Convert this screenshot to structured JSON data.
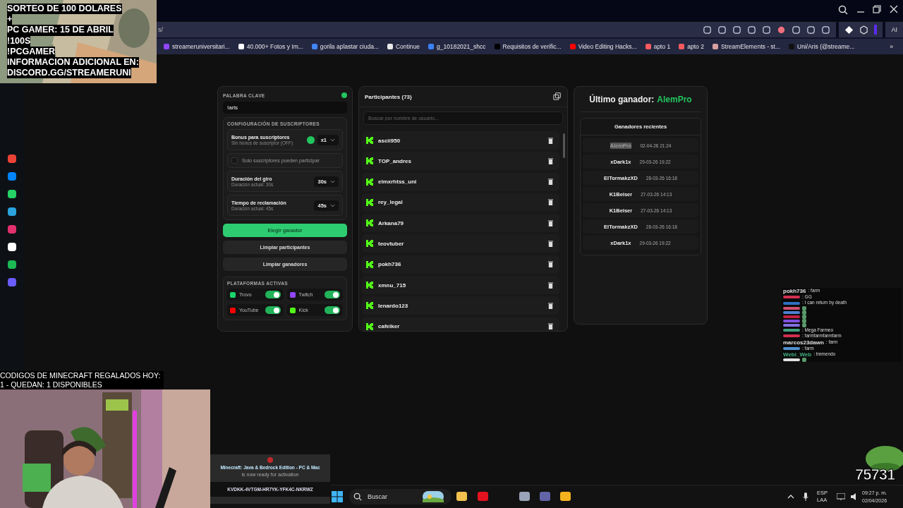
{
  "promo_overlay": {
    "lines": [
      "SORTEO DE 100 DOLARES",
      "+",
      "PC GAMER: 15 DE ABRIL",
      "!100S",
      "!PCGAMER",
      "INFORMACION ADICIONAL EN:",
      "DISCORD.GG/STREAMERUNI"
    ]
  },
  "browser": {
    "address": "s/",
    "bookmarks": [
      {
        "label": "streameruniversitari...",
        "kind": "twitch"
      },
      {
        "label": "40.000+ Fotos y Im...",
        "kind": "pexels"
      },
      {
        "label": "gorila aplastar ciuda...",
        "kind": "google"
      },
      {
        "label": "Continue",
        "kind": "doc"
      },
      {
        "label": "g_10182021_shcc",
        "kind": "edge"
      },
      {
        "label": "Requisitos de verific...",
        "kind": "x"
      },
      {
        "label": "Video Editing Hacks...",
        "kind": "youtube"
      },
      {
        "label": "apto 1",
        "kind": "airbnb"
      },
      {
        "label": "apto 2",
        "kind": "airbnb2"
      },
      {
        "label": "StreamElements - st...",
        "kind": "se"
      },
      {
        "label": "Uni/Aris (@streame...",
        "kind": "tiktok"
      }
    ],
    "more": "»",
    "ai": "AI"
  },
  "settings": {
    "keyword_label": "PALABRA CLAVE",
    "keyword": "!aris",
    "subs_title": "CONFIGURACIÓN DE SUSCRIPTORES",
    "options": [
      {
        "kind": "select",
        "title": "Bonus para suscriptores",
        "subtitle": "Sin bonus de suscriptor (OFF)",
        "value": "x1",
        "info": true
      },
      {
        "kind": "checkbox",
        "title": "Solo suscriptores pueden participar",
        "checked": false
      },
      {
        "kind": "select",
        "title": "Duración del giro",
        "subtitle": "Duración actual: 30s",
        "value": "30s",
        "info": false
      },
      {
        "kind": "select",
        "title": "Tiempo de reclamación",
        "subtitle": "Duración actual: 45s",
        "value": "45s",
        "info": false
      }
    ],
    "buttons": [
      {
        "label": "Elegir ganador",
        "kind": "primary"
      },
      {
        "label": "Limpiar participantes",
        "kind": "secondary"
      },
      {
        "label": "Limpiar ganadores",
        "kind": "secondary"
      }
    ],
    "platforms_title": "PLATAFORMAS ACTIVAS",
    "platforms": [
      {
        "name": "Trovo",
        "kind": "trovo",
        "on": true
      },
      {
        "name": "Twitch",
        "kind": "twitch",
        "on": true
      },
      {
        "name": "YouTube",
        "kind": "youtube",
        "on": true
      },
      {
        "name": "Kick",
        "kind": "kick",
        "on": true
      }
    ]
  },
  "participants": {
    "title": "Participantes (73)",
    "search": {
      "placeholder": "Buscar por nombre de usuario..."
    },
    "names": [
      "ascii950",
      "TOP_andres",
      "elmxrhtss_uni",
      "rey_legal",
      "Arkana79",
      "teovtuber",
      "pokh736",
      "xmnu_715",
      "lenardo123",
      "cafeiker"
    ]
  },
  "winner": {
    "label": "Último ganador:",
    "name": "AlemPro",
    "recent_title": "Ganadores recientes",
    "recent": [
      {
        "name": "AlemPro",
        "date": "02-04-26 21:24",
        "selected": true
      },
      {
        "name": "xDark1x",
        "date": "29-03-26 19:22",
        "selected": false
      },
      {
        "name": "ElTormakzXD",
        "date": "28-03-26 16:18",
        "selected": false
      },
      {
        "name": "K1Beiser",
        "date": "27-03-26 14:13",
        "selected": false
      },
      {
        "name": "K1Beiser",
        "date": "27-03-26 14:13",
        "selected": false
      },
      {
        "name": "ElTormakzXD",
        "date": "28-03-26 16:18",
        "selected": false
      },
      {
        "name": "xDark1x",
        "date": "29-03-26 19:22",
        "selected": false
      }
    ]
  },
  "chat": {
    "messages": [
      {
        "user": "pokh736",
        "text": ": farm",
        "color": "#e0e0e0"
      },
      {
        "text": ": GG",
        "color": "#d03050"
      },
      {
        "text": ": I can return by death",
        "color": "#3070c0"
      },
      {
        "emote": true,
        "color": "#d05070"
      },
      {
        "emote": true,
        "color": "#5080d0"
      },
      {
        "emote": true,
        "color": "#c02040"
      },
      {
        "emote": true,
        "color": "#8050e0"
      },
      {
        "emote": true,
        "color": "#8070e0"
      },
      {
        "text": ": Mega Farmeo",
        "color": "#40a080"
      },
      {
        "text": ": farmfarmfarmfarm",
        "color": "#d03050"
      },
      {
        "user": "marcos23dawn",
        "text": ": farm",
        "color": "#e0e0e0"
      },
      {
        "text": ": farm",
        "color": "#5090d0"
      },
      {
        "user": "Webi_Web",
        "text": ": tremendo",
        "color": "#40b080"
      },
      {
        "emote": true,
        "color": "#e0e0e0"
      }
    ]
  },
  "codes_overlay": {
    "lines": [
      "CODIGOS DE MINECRAFT REGALADOS HOY:",
      "1 - QUEDAN: 1 DISPONIBLES"
    ]
  },
  "code_card": {
    "title": "Minecraft: Java & Bedrock Edition - PC & Mac",
    "subtitle": "is now ready for activation",
    "code": "KVDKK-4VTGM-HR7YK-YFK4C-NKRWZ"
  },
  "counter": "75731",
  "taskbar": {
    "search": {
      "placeholder": "Buscar"
    },
    "language": [
      "ESP",
      "LAA"
    ],
    "time": "09:27 p. m.",
    "date": "02/04/2026"
  }
}
